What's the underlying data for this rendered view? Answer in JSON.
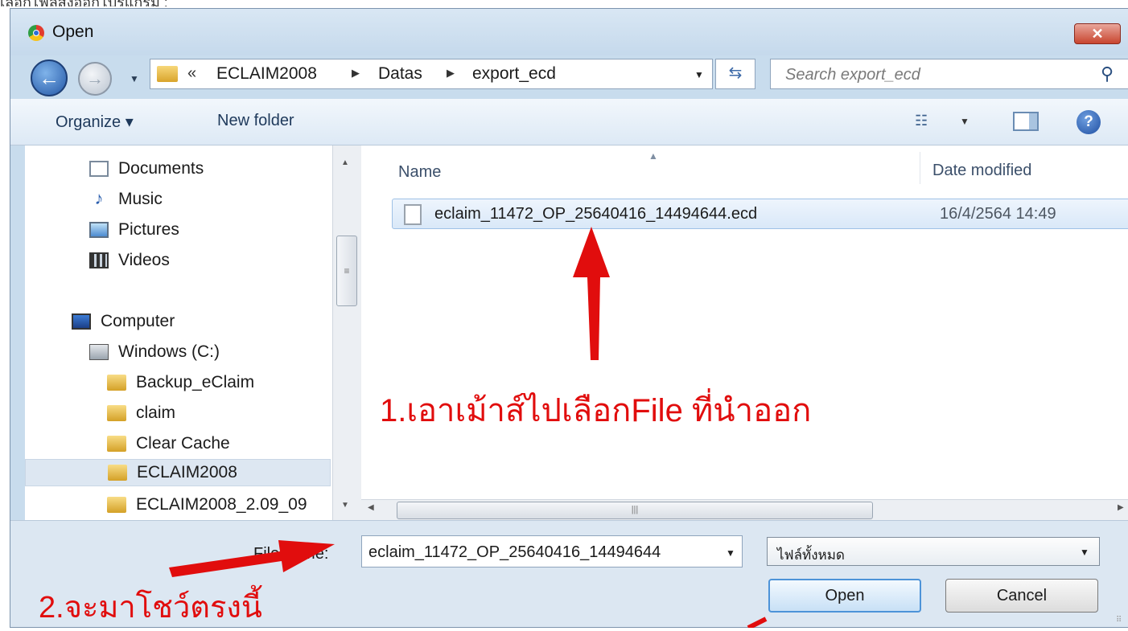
{
  "page_caption": "เลือกไฟล์ส่งออกโปรแกรม :",
  "window": {
    "title": "Open",
    "close_label": "✕"
  },
  "nav": {
    "path_overflow": "«",
    "breadcrumbs": [
      "ECLAIM2008",
      "Datas",
      "export_ecd"
    ],
    "search_placeholder": "Search export_ecd"
  },
  "toolbar": {
    "organize_label": "Organize ▾",
    "new_folder_label": "New folder"
  },
  "sidebar": {
    "items": [
      {
        "label": "Documents",
        "icon": "document-icon"
      },
      {
        "label": "Music",
        "icon": "music-icon"
      },
      {
        "label": "Pictures",
        "icon": "pictures-icon"
      },
      {
        "label": "Videos",
        "icon": "videos-icon"
      },
      {
        "label": "Computer",
        "icon": "computer-icon"
      },
      {
        "label": "Windows (C:)",
        "icon": "drive-icon"
      },
      {
        "label": "Backup_eClaim",
        "icon": "folder-icon"
      },
      {
        "label": "claim",
        "icon": "folder-icon"
      },
      {
        "label": "Clear Cache",
        "icon": "folder-icon"
      },
      {
        "label": "ECLAIM2008",
        "icon": "folder-icon",
        "selected": true
      },
      {
        "label": "ECLAIM2008_2.09_09",
        "icon": "folder-icon"
      }
    ]
  },
  "file_list": {
    "columns": [
      "Name",
      "Date modified"
    ],
    "files": [
      {
        "name": "eclaim_11472_OP_25640416_14494644.ecd",
        "date_modified": "16/4/2564 14:49"
      }
    ]
  },
  "footer": {
    "file_name_label": "File name:",
    "file_name_value": "eclaim_11472_OP_25640416_14494644",
    "file_type_value": "ไฟล์ทั้งหมด",
    "open_label": "Open",
    "cancel_label": "Cancel"
  },
  "annotations": {
    "step1": "1.เอาเม้าส์ไปเลือกFile ที่นำออก",
    "step2": "2.จะมาโชว์ตรงนี้",
    "color": "#e10d0d"
  }
}
